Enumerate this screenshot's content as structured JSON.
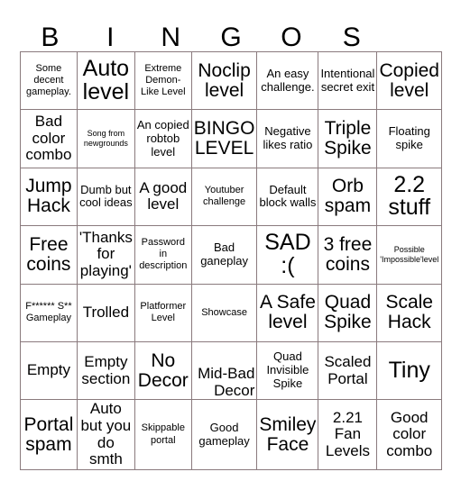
{
  "header": {
    "letters": [
      "B",
      "I",
      "N",
      "G",
      "O",
      "S",
      ""
    ]
  },
  "grid": {
    "columns": 7,
    "rows": 7,
    "border_color": "#8a7a7d",
    "cells": [
      {
        "text": "Some decent gameplay.",
        "size": "s"
      },
      {
        "text": "Auto level",
        "size": "xxl"
      },
      {
        "text": "Extreme Demon-Like Level",
        "size": "s"
      },
      {
        "text": "Noclip level",
        "size": "xl"
      },
      {
        "text": "An easy challenge.",
        "size": "m"
      },
      {
        "text": "Intentional secret exit",
        "size": "m"
      },
      {
        "text": "Copied level",
        "size": "xl"
      },
      {
        "text": "Bad color combo",
        "size": "l"
      },
      {
        "text": "Song from newgrounds",
        "size": "xs"
      },
      {
        "text": "An copied robtob level",
        "size": "m"
      },
      {
        "text": "BINGO LEVEL",
        "size": "xl"
      },
      {
        "text": "Negative likes ratio",
        "size": "m"
      },
      {
        "text": "Triple Spike",
        "size": "xl"
      },
      {
        "text": "Floating spike",
        "size": "m"
      },
      {
        "text": "Jump Hack",
        "size": "xl"
      },
      {
        "text": "Dumb but cool ideas",
        "size": "m"
      },
      {
        "text": "A good level",
        "size": "l"
      },
      {
        "text": "Youtuber challenge",
        "size": "s"
      },
      {
        "text": "Default block walls",
        "size": "m"
      },
      {
        "text": "Orb spam",
        "size": "xl"
      },
      {
        "text": "2.2 stuff",
        "size": "xxl"
      },
      {
        "text": "Free coins",
        "size": "xl"
      },
      {
        "text": "'Thanks for playing'",
        "size": "l"
      },
      {
        "text": "Password in description",
        "size": "s"
      },
      {
        "text": "Bad ganeplay",
        "size": "m"
      },
      {
        "text": "SAD :(",
        "size": "xxl"
      },
      {
        "text": "3 free coins",
        "size": "xl"
      },
      {
        "text": "Possible 'Impossible'level",
        "size": "xs"
      },
      {
        "text": "F****** S** Gameplay",
        "size": "s"
      },
      {
        "text": "Trolled",
        "size": "l"
      },
      {
        "text": "Platformer Level",
        "size": "s"
      },
      {
        "text": "Showcase",
        "size": "s"
      },
      {
        "text": "A Safe level",
        "size": "xl"
      },
      {
        "text": "Quad Spike",
        "size": "xl"
      },
      {
        "text": "Scale Hack",
        "size": "xl"
      },
      {
        "text": "Empty",
        "size": "l"
      },
      {
        "text": "Empty section",
        "size": "l"
      },
      {
        "text": "No Decor",
        "size": "xl"
      },
      {
        "text": "Mid-Bad Decor",
        "size": "overflow"
      },
      {
        "text": "Quad Invisible Spike",
        "size": "m"
      },
      {
        "text": "Scaled Portal",
        "size": "l"
      },
      {
        "text": "Tiny",
        "size": "xxl"
      },
      {
        "text": "Portal spam",
        "size": "xl"
      },
      {
        "text": "Auto but you do smth",
        "size": "l"
      },
      {
        "text": "Skippable portal",
        "size": "s"
      },
      {
        "text": "Good gameplay",
        "size": "m"
      },
      {
        "text": "Smiley Face",
        "size": "xl"
      },
      {
        "text": "2.21 Fan Levels",
        "size": "l"
      },
      {
        "text": "Good color combo",
        "size": "l"
      }
    ]
  }
}
